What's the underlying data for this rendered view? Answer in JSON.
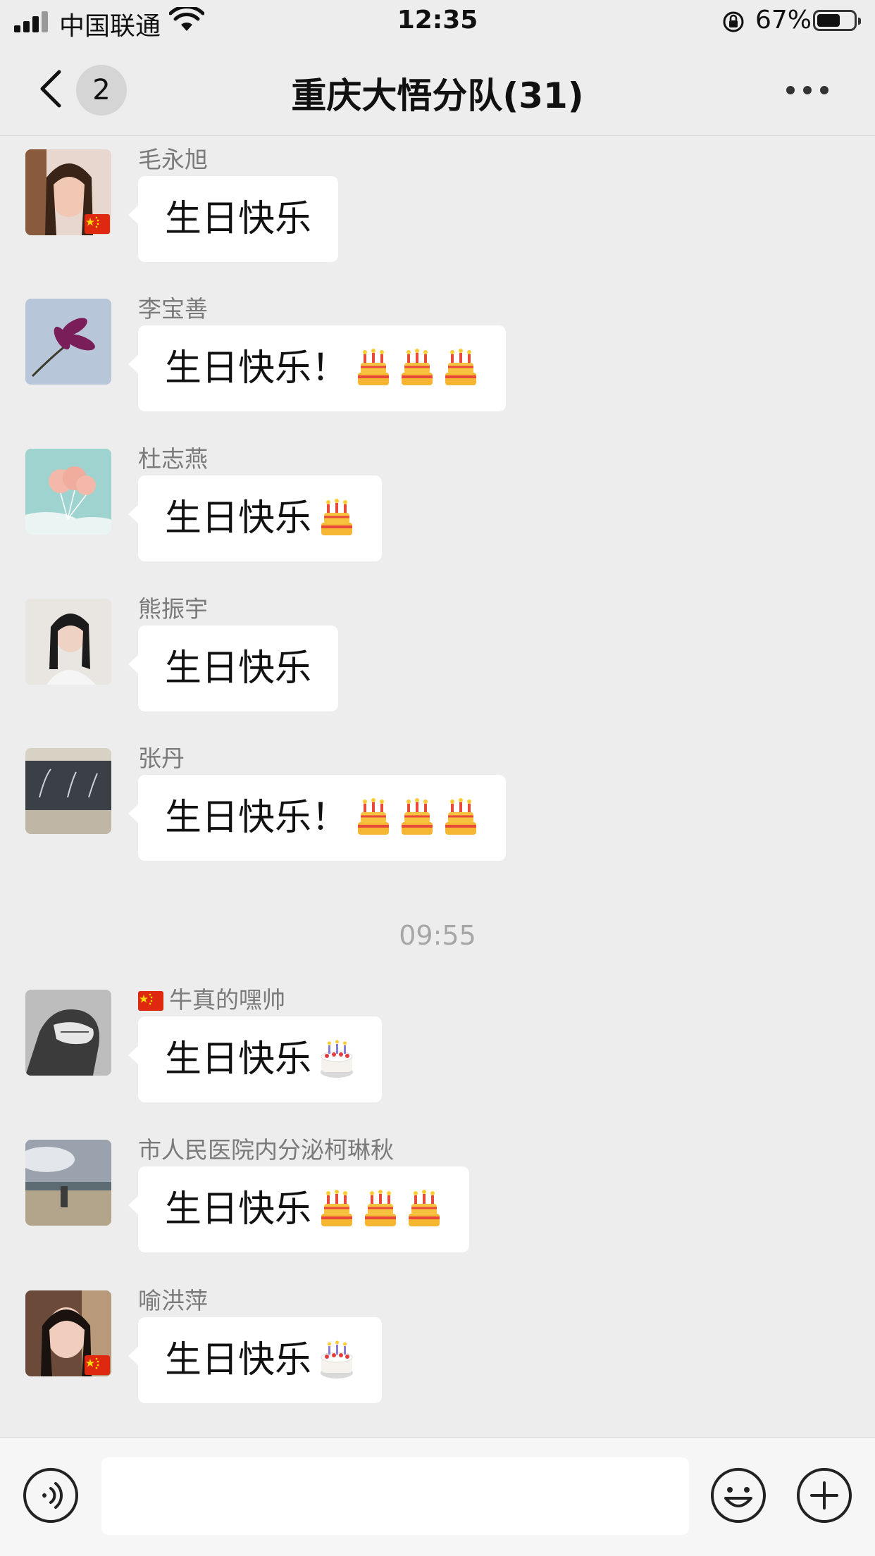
{
  "status_bar": {
    "carrier": "中国联通",
    "time": "12:35",
    "battery_percent": "67%",
    "battery_level": 0.67
  },
  "nav": {
    "back_badge": "2",
    "title": "重庆大悟分队(31)"
  },
  "messages": [
    {
      "name": "毛永旭",
      "text": "生日快乐",
      "emoji": [],
      "flag": true
    },
    {
      "name": "李宝善",
      "text": "生日快乐！",
      "emoji": [
        "birthday-cake",
        "birthday-cake",
        "birthday-cake"
      ],
      "flag": false
    },
    {
      "name": "杜志燕",
      "text": "生日快乐",
      "emoji": [
        "birthday-cake"
      ],
      "flag": false
    },
    {
      "name": "熊振宇",
      "text": "生日快乐",
      "emoji": [],
      "flag": false
    },
    {
      "name": "张丹",
      "text": "生日快乐！",
      "emoji": [
        "birthday-cake",
        "birthday-cake",
        "birthday-cake"
      ],
      "flag": false
    },
    {
      "name": "牛真的嘿帅",
      "text": "生日快乐",
      "emoji": [
        "shortcake"
      ],
      "name_flag": true
    },
    {
      "name": "市人民医院内分泌柯琳秋",
      "text": "生日快乐",
      "emoji": [
        "birthday-cake",
        "birthday-cake",
        "birthday-cake"
      ],
      "flag": false
    },
    {
      "name": "喻洪萍",
      "text": "生日快乐",
      "emoji": [
        "shortcake"
      ],
      "flag": true
    }
  ],
  "timestamp": "09:55",
  "input": {
    "placeholder": ""
  },
  "colors": {
    "background": "#ededed",
    "bubble": "#ffffff",
    "name_text": "#7a7a7a"
  }
}
